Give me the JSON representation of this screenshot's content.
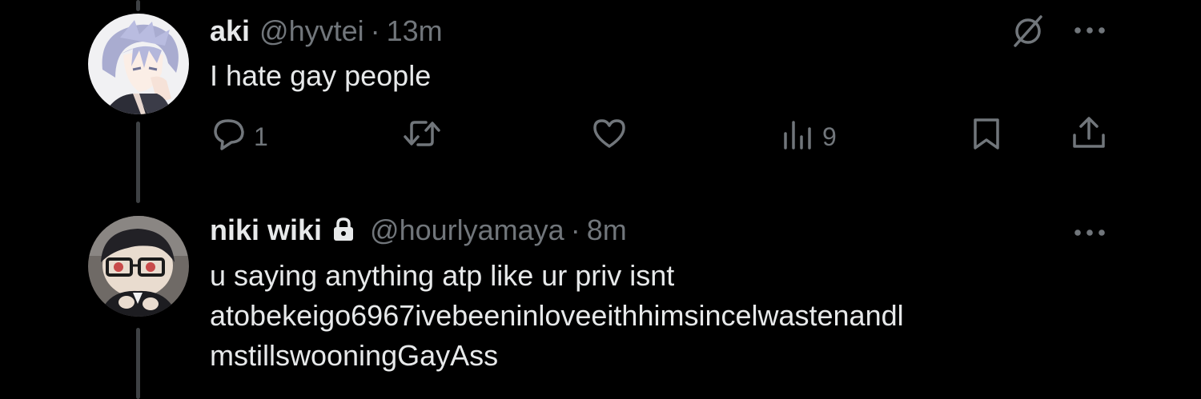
{
  "tweets": [
    {
      "display_name": "aki",
      "handle": "@hyvtei",
      "separator": "·",
      "time": "13m",
      "text_lines": [
        "I hate gay people"
      ],
      "actions": {
        "reply_count": "1",
        "retweet_count": "",
        "like_count": "",
        "views_count": "9"
      },
      "icons": [
        "grok-icon",
        "more-icon",
        "reply-icon",
        "retweet-icon",
        "like-icon",
        "views-icon",
        "bookmark-icon",
        "share-icon"
      ]
    },
    {
      "display_name": "niki wiki",
      "handle": "@hourlyamaya",
      "separator": "·",
      "time": "8m",
      "text_lines": [
        "u saying anything atp like ur priv isnt",
        "atobekeigo6967ivebeeninloveeithhimsincelwastenandl",
        "mstillswooningGayAss"
      ],
      "icons": [
        "lock-icon",
        "more-icon"
      ]
    }
  ],
  "colors": {
    "background": "#000000",
    "primary_text": "#e7e9ea",
    "secondary_text": "#71767b",
    "thread_line": "#3e4144"
  }
}
